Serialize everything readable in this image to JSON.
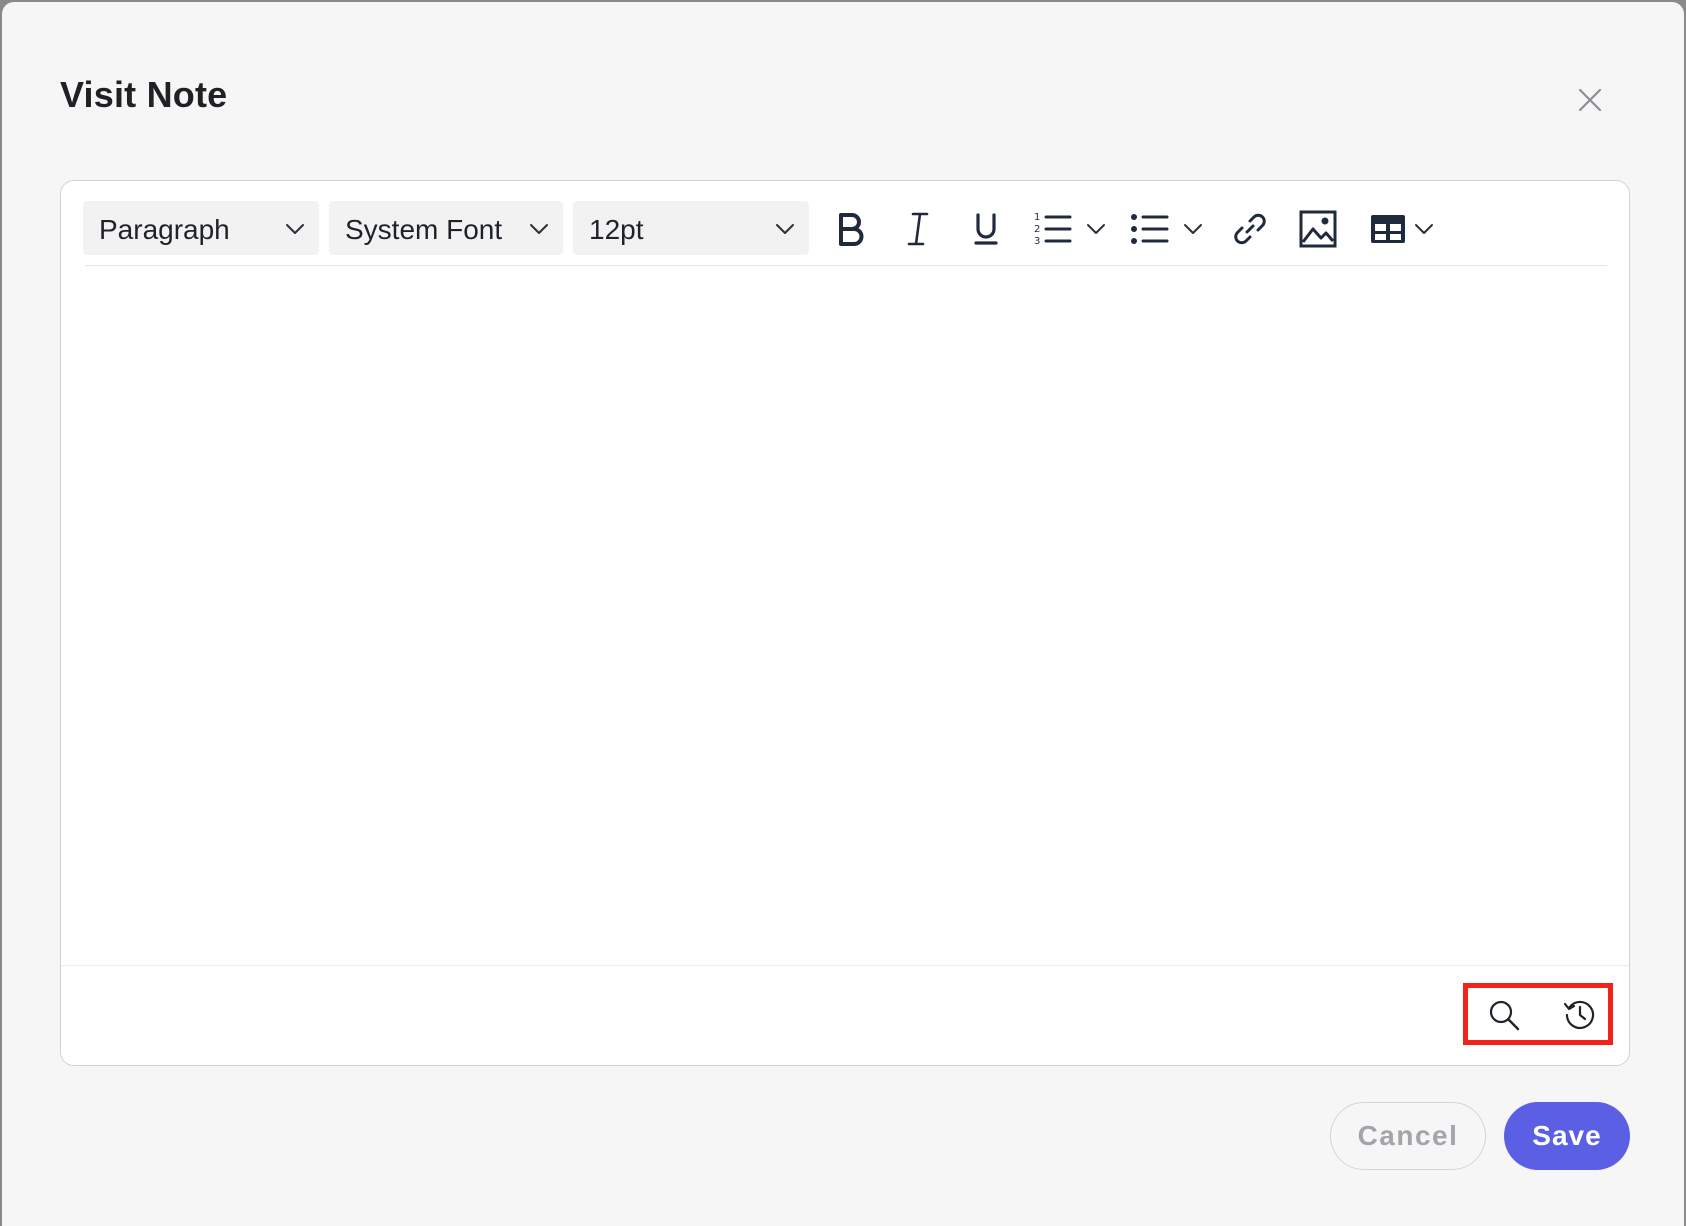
{
  "dialog": {
    "title": "Visit Note"
  },
  "toolbar": {
    "block_format": "Paragraph",
    "font_family": "System Font",
    "font_size": "12pt",
    "tools": [
      "bold-icon",
      "italic-icon",
      "underline-icon",
      "numbered-list-icon",
      "bullet-list-icon",
      "link-icon",
      "image-icon",
      "table-icon"
    ]
  },
  "statusbar": {
    "icons": [
      "search-icon",
      "history-icon"
    ],
    "highlight_color": "#f2231a"
  },
  "footer": {
    "cancel_label": "Cancel",
    "save_label": "Save"
  },
  "colors": {
    "accent": "#5b5fe3",
    "background": "#f6f6f7"
  }
}
